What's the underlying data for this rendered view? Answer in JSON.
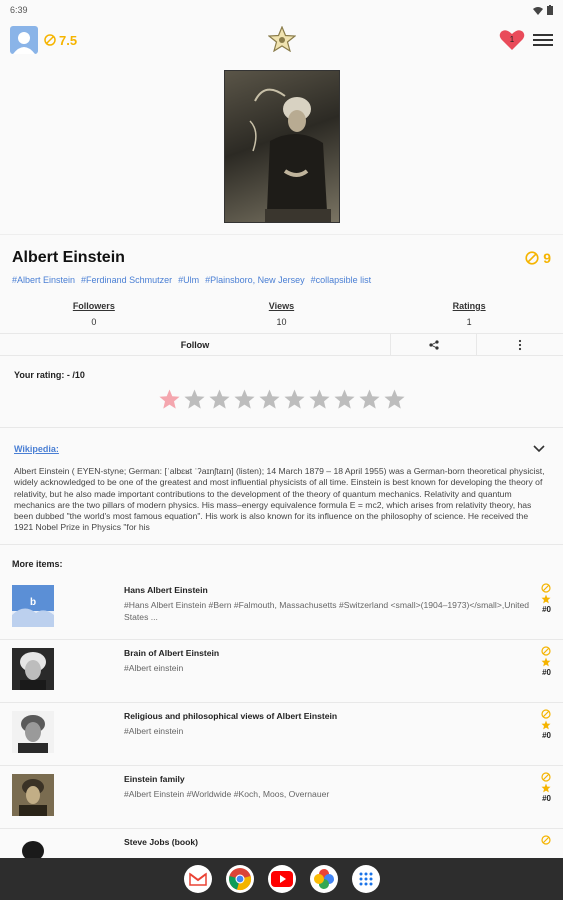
{
  "status": {
    "time": "6:39"
  },
  "topbar": {
    "score": "7.5"
  },
  "article": {
    "title": "Albert Einstein",
    "rating": "9",
    "tags": [
      "#Albert Einstein",
      "#Ferdinand Schmutzer",
      "#Ulm",
      "#Plainsboro, New Jersey",
      "#collapsible list"
    ],
    "stats": [
      {
        "label": "Followers",
        "value": "0"
      },
      {
        "label": "Views",
        "value": "10"
      },
      {
        "label": "Ratings",
        "value": "1"
      }
    ],
    "follow_label": "Follow",
    "your_rating_label": "Your rating: - /10",
    "stars_total": 10,
    "stars_highlighted": 1
  },
  "wiki": {
    "title": "Wikipedia:",
    "text": "Albert Einstein ( EYEN-styne; German: [ˈalbɛʁt ˈʔaɪnʃtaɪn] (listen); 14 March 1879 – 18 April 1955) was a German-born theoretical physicist, widely acknowledged to be one of the greatest and most influential physicists of all time. Einstein is best known for developing the theory of relativity, but he also made important contributions to the development of the theory of quantum mechanics. Relativity and quantum mechanics are the two pillars of modern physics. His mass–energy equivalence formula E = mc2, which arises from relativity theory, has been dubbed \"the world's most famous equation\". His work is also known for its influence on the philosophy of science. He received the 1921 Nobel Prize in Physics \"for his"
  },
  "more_items": {
    "label": "More items:",
    "items": [
      {
        "title": "Hans Albert Einstein",
        "desc": "#Hans Albert Einstein #Bern #Falmouth, Massachusetts #Switzerland <small>(1904–1973)</small>,United States ...",
        "count": "#0"
      },
      {
        "title": "Brain of Albert Einstein",
        "desc": "#Albert einstein",
        "count": "#0"
      },
      {
        "title": "Religious and philosophical views of Albert Einstein",
        "desc": "#Albert einstein",
        "count": "#0"
      },
      {
        "title": "Einstein family",
        "desc": "#Albert Einstein #Worldwide #Koch, Moos, Overnauer",
        "count": "#0"
      },
      {
        "title": "Steve Jobs (book)",
        "desc": "",
        "count": ""
      }
    ]
  },
  "colors": {
    "accent": "#f5b400",
    "link": "#4a7fd4",
    "heart": "#e94b5a",
    "star_active": "#f4a6ae",
    "star_inactive": "#bdbdbd"
  }
}
